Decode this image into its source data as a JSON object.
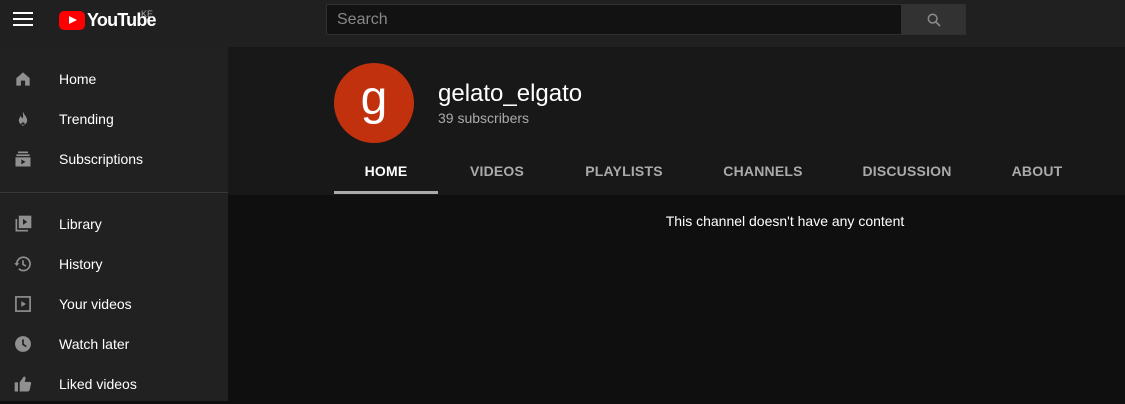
{
  "topbar": {
    "logo_text": "YouTube",
    "country_code": "KE",
    "search_placeholder": "Search"
  },
  "sidebar": {
    "items": [
      {
        "label": "Home",
        "icon": "home-icon"
      },
      {
        "label": "Trending",
        "icon": "flame-icon"
      },
      {
        "label": "Subscriptions",
        "icon": "subscriptions-icon"
      },
      {
        "label": "Library",
        "icon": "library-icon"
      },
      {
        "label": "History",
        "icon": "history-icon"
      },
      {
        "label": "Your videos",
        "icon": "video-icon"
      },
      {
        "label": "Watch later",
        "icon": "clock-icon"
      },
      {
        "label": "Liked videos",
        "icon": "thumbs-up-icon"
      }
    ]
  },
  "channel": {
    "avatar_letter": "g",
    "avatar_color": "#c2310e",
    "name": "gelato_elgato",
    "subscribers": "39 subscribers",
    "tabs": [
      "HOME",
      "VIDEOS",
      "PLAYLISTS",
      "CHANNELS",
      "DISCUSSION",
      "ABOUT"
    ],
    "active_tab": "HOME"
  },
  "content": {
    "empty_message": "This channel doesn't have any content"
  }
}
